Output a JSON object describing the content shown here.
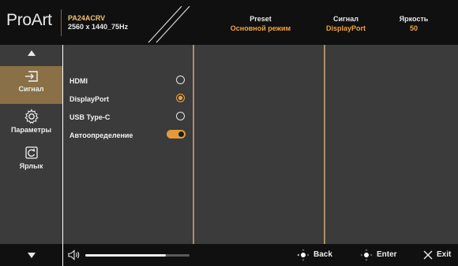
{
  "header": {
    "brand": "ProArt",
    "model": "PA24ACRV",
    "resolution": "2560 x 1440_75Hz",
    "preset_label": "Preset",
    "preset_value": "Основной режим",
    "signal_label": "Сигнал",
    "signal_value": "DisplayPort",
    "brightness_label": "Яркость",
    "brightness_value": "50"
  },
  "sidebar": {
    "items": [
      {
        "label": "Сигнал",
        "icon": "input-icon"
      },
      {
        "label": "Параметры",
        "icon": "settings-gear-icon"
      },
      {
        "label": "Ярлык",
        "icon": "shortcut-icon"
      }
    ]
  },
  "signal_options": [
    {
      "label": "HDMI",
      "selected": false
    },
    {
      "label": "DisplayPort",
      "selected": true
    },
    {
      "label": "USB Type-C",
      "selected": false
    }
  ],
  "auto_detect": {
    "label": "Автоопределение",
    "enabled": true
  },
  "footer": {
    "volume_level": 0.77,
    "back_label": "Back",
    "enter_label": "Enter",
    "exit_label": "Exit"
  },
  "colors": {
    "accent": "#f0a33c",
    "active_item": "#8a7046",
    "panel": "#3b3b3b",
    "bar": "#101010"
  }
}
